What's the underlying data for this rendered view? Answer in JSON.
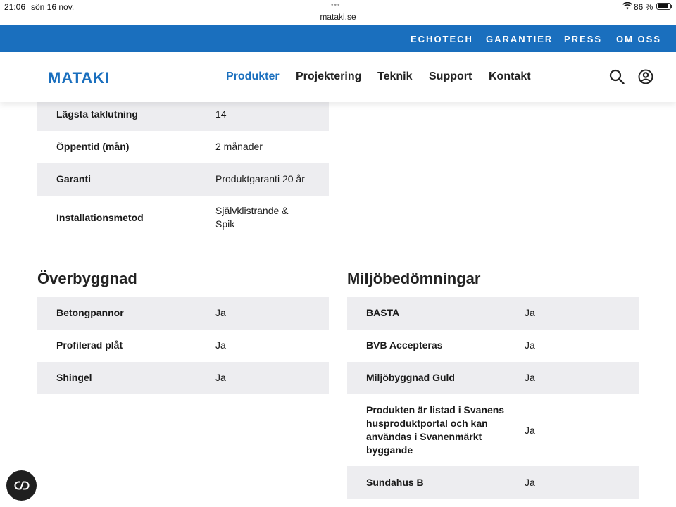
{
  "status_bar": {
    "time": "21:06",
    "date": "sön 16 nov.",
    "url": "mataki.se",
    "battery": "86 %"
  },
  "top_bar": {
    "links": [
      "ECHOTECH",
      "GARANTIER",
      "PRESS",
      "OM OSS"
    ]
  },
  "nav": {
    "logo": "MATAKI",
    "links": [
      "Produkter",
      "Projektering",
      "Teknik",
      "Support",
      "Kontakt"
    ],
    "active": "Produkter"
  },
  "specs": [
    {
      "label": "Lägsta taklutning",
      "value": "14"
    },
    {
      "label": "Öppentid (mån)",
      "value": "2 månader"
    },
    {
      "label": "Garanti",
      "value": "Produktgaranti 20 år"
    },
    {
      "label": "Installationsmetod",
      "value_lines": [
        "Självklistrande &",
        "Spik"
      ]
    }
  ],
  "overbyggnad": {
    "title": "Överbyggnad",
    "rows": [
      {
        "label": "Betongpannor",
        "value": "Ja"
      },
      {
        "label": "Profilerad plåt",
        "value": "Ja"
      },
      {
        "label": "Shingel",
        "value": "Ja"
      }
    ]
  },
  "miljo": {
    "title": "Miljöbedömningar",
    "rows": [
      {
        "label": "BASTA",
        "value": "Ja"
      },
      {
        "label": "BVB Accepteras",
        "value": "Ja"
      },
      {
        "label": "Miljöbyggnad Guld",
        "value": "Ja"
      },
      {
        "label_lines": [
          "Produkten är listad i Svanens",
          "husproduktportal och kan",
          "användas i Svanenmärkt",
          "byggande"
        ],
        "value": "Ja"
      },
      {
        "label": "Sundahus B",
        "value": "Ja"
      }
    ]
  },
  "colors": {
    "brand_blue": "#1a6fbe",
    "row_alt": "#ededf0",
    "chat_button": "#1f1f1f"
  },
  "icons": [
    "search-icon",
    "user-icon",
    "chat-icon",
    "wifi-icon",
    "battery-icon"
  ]
}
